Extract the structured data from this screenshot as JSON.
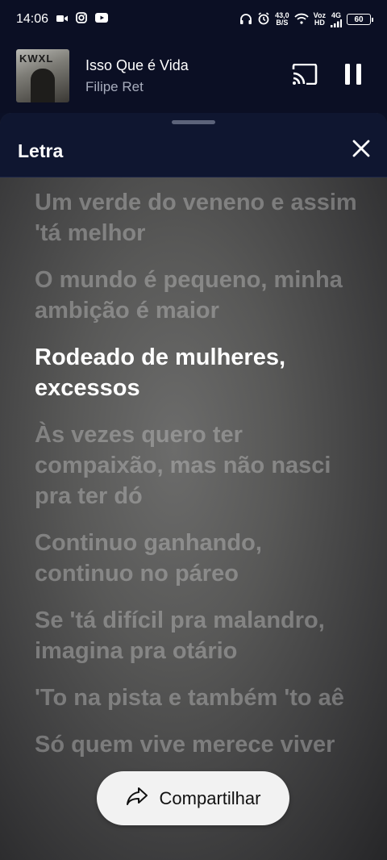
{
  "status_bar": {
    "time": "14:06",
    "net_speed": "43,0",
    "net_unit": "B/S",
    "volte": "Voz",
    "hd": "HD",
    "network": "4G",
    "battery": "60"
  },
  "mini_player": {
    "album_art_text": "KWXL",
    "title": "Isso Que é Vida",
    "artist": "Filipe Ret"
  },
  "sheet": {
    "title": "Letra"
  },
  "lyrics": [
    {
      "text": "Um verde do veneno e assim 'tá melhor",
      "active": false
    },
    {
      "text": "O mundo é pequeno, minha ambição é maior",
      "active": false
    },
    {
      "text": "Rodeado de mulheres, excessos",
      "active": true
    },
    {
      "text": "Às vezes quero ter compaixão, mas não nasci pra ter dó",
      "active": false
    },
    {
      "text": "Continuo ganhando, continuo no páreo",
      "active": false
    },
    {
      "text": "Se 'tá difícil pra malandro, imagina pra otário",
      "active": false
    },
    {
      "text": "'To na pista e também 'to aê",
      "active": false
    },
    {
      "text": "Só quem vive merece viver",
      "active": false
    }
  ],
  "share": {
    "label": "Compartilhar"
  }
}
